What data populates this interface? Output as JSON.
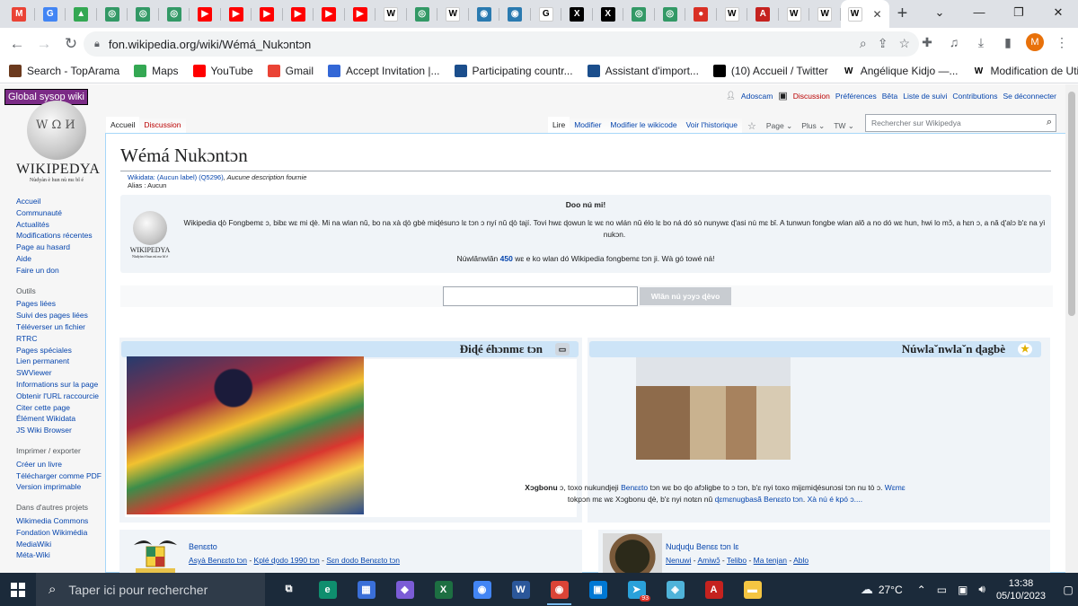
{
  "browser": {
    "tabs": [
      {
        "icon": "gmail-icon",
        "glyph": "M",
        "color": "#ea4335"
      },
      {
        "icon": "google-translate-icon",
        "glyph": "G",
        "color": "#4285f4"
      },
      {
        "icon": "google-drive-icon",
        "glyph": "▲",
        "color": "#34a853"
      },
      {
        "icon": "wikimedia-icon",
        "glyph": "◎",
        "color": "#339966"
      },
      {
        "icon": "wikimedia-icon",
        "glyph": "◎",
        "color": "#339966"
      },
      {
        "icon": "wikimedia-icon",
        "glyph": "◎",
        "color": "#339966"
      },
      {
        "icon": "youtube-icon",
        "glyph": "▶",
        "color": "#ff0000"
      },
      {
        "icon": "youtube-icon",
        "glyph": "▶",
        "color": "#ff0000"
      },
      {
        "icon": "youtube-icon",
        "glyph": "▶",
        "color": "#ff0000"
      },
      {
        "icon": "youtube-icon",
        "glyph": "▶",
        "color": "#ff0000"
      },
      {
        "icon": "youtube-icon",
        "glyph": "▶",
        "color": "#ff0000"
      },
      {
        "icon": "youtube-icon",
        "glyph": "▶",
        "color": "#ff0000"
      },
      {
        "icon": "wikipedia-icon",
        "glyph": "W",
        "color": "#ffffff"
      },
      {
        "icon": "wikimedia-icon",
        "glyph": "◎",
        "color": "#339966"
      },
      {
        "icon": "wikipedia-icon",
        "glyph": "W",
        "color": "#ffffff"
      },
      {
        "icon": "wikiproject-icon",
        "glyph": "◉",
        "color": "#2a7ab0"
      },
      {
        "icon": "wikiproject-icon",
        "glyph": "◉",
        "color": "#2a7ab0"
      },
      {
        "icon": "google-icon",
        "glyph": "G",
        "color": "#ffffff"
      },
      {
        "icon": "x-icon",
        "glyph": "X",
        "color": "#000000"
      },
      {
        "icon": "x-icon",
        "glyph": "X",
        "color": "#000000"
      },
      {
        "icon": "wikimedia-icon",
        "glyph": "◎",
        "color": "#339966"
      },
      {
        "icon": "wikimedia-icon",
        "glyph": "◎",
        "color": "#339966"
      },
      {
        "icon": "record-icon",
        "glyph": "●",
        "color": "#d93025"
      },
      {
        "icon": "wikipedia-icon",
        "glyph": "W",
        "color": "#ffffff"
      },
      {
        "icon": "pdf-icon",
        "glyph": "A",
        "color": "#c5221f"
      },
      {
        "icon": "wikipedia-icon",
        "glyph": "W",
        "color": "#ffffff"
      },
      {
        "icon": "wikipedia-icon",
        "glyph": "W",
        "color": "#ffffff"
      }
    ],
    "active_tab_glyph": "W",
    "close_glyph": "✕",
    "new_tab_glyph": "+",
    "window_controls": [
      "⌄",
      "—",
      "❐",
      "✕"
    ],
    "url": "fon.wikipedia.org/wiki/Wémá_Nukɔntɔn",
    "profile_initial": "M",
    "bookmarks": [
      {
        "icon": "toparama-icon",
        "color": "#6b3a1e",
        "label": "Search - TopArama"
      },
      {
        "icon": "maps-icon",
        "color": "#34a853",
        "label": "Maps"
      },
      {
        "icon": "youtube-icon",
        "color": "#ff0000",
        "label": "YouTube"
      },
      {
        "icon": "gmail-icon",
        "color": "#ea4335",
        "label": "Gmail"
      },
      {
        "icon": "invitation-icon",
        "color": "#3367d6",
        "label": "Accept Invitation |..."
      },
      {
        "icon": "wikimedia-icon",
        "color": "#1b4e8c",
        "label": "Participating countr..."
      },
      {
        "icon": "wikimedia-icon",
        "color": "#1b4e8c",
        "label": "Assistant d'import..."
      },
      {
        "icon": "x-icon",
        "color": "#000000",
        "label": "(10) Accueil / Twitter"
      },
      {
        "icon": "wikipedia-icon",
        "color": "#ffffff",
        "label": "Angélique Kidjo —..."
      },
      {
        "icon": "wikipedia-icon",
        "color": "#ffffff",
        "label": "Modification de Util..."
      }
    ]
  },
  "wiki": {
    "sysop_badge": "Global sysop wiki",
    "wordmark": "WIKIPEDYA",
    "tagline": "Nùdyàn è hun nù mɛ bǐ é",
    "sidebar": {
      "nav": [
        "Accueil",
        "Communauté",
        "Actualités",
        "Modifications récentes",
        "Page au hasard",
        "Aide",
        "Faire un don"
      ],
      "tools_title": "Outils",
      "tools": [
        "Pages liées",
        "Suivi des pages liées",
        "Téléverser un fichier",
        "RTRC",
        "Pages spéciales",
        "Lien permanent",
        "SWViewer",
        "Informations sur la page",
        "Obtenir l'URL raccourcie",
        "Citer cette page",
        "Élément Wikidata",
        "JS Wiki Browser"
      ],
      "print_title": "Imprimer / exporter",
      "print": [
        "Créer un livre",
        "Télécharger comme PDF",
        "Version imprimable"
      ],
      "other_title": "Dans d'autres projets",
      "other": [
        "Wikimedia Commons",
        "Fondation Wikimédia",
        "MediaWiki",
        "Méta-Wiki"
      ]
    },
    "personal": {
      "user": "Adoscam",
      "discussion": "Discussion",
      "preferences": "Préférences",
      "beta": "Bêta",
      "watchlist": "Liste de suivi",
      "contributions": "Contributions",
      "logout": "Se déconnecter"
    },
    "ns_tabs": {
      "main": "Accueil",
      "talk": "Discussion"
    },
    "view_tabs": {
      "read": "Lire",
      "edit": "Modifier",
      "edit_source": "Modifier le wikicode",
      "history": "Voir l'historique",
      "page": "Page",
      "more": "Plus",
      "tw": "TW"
    },
    "search_placeholder": "Rechercher sur Wikipedya",
    "title": "Wémá Nukɔntɔn",
    "wikidata_line": "Wikidata: (Aucun label) (Q5296), Aucune description fournie",
    "wikidata_link": "Wikidata: (Aucun label) (Q5296)",
    "wikidata_desc": ", Aucune description fournie",
    "alias_line": "Alias : Aucun",
    "welcome": {
      "heading": "Doo nú mi!",
      "body": "Wikipedia ɖò Fongbemɛ ɔ, bibɛ wɛ mi ɖè. Mi na wlan nǔ, bo na xà ɖò gbè miɖésunɔ lɛ tɔn ɔ nyí nǔ ɖò tají. Tovi hwɛ ɖowun lɛ wɛ no wlán nǔ élo lɛ bo ná dó sò nunywɛ ɖ'asi nú mɛ bǐ. A tunwun fongbe wlan alǒ a no dó wɛ hun, hwi lo mɔ̌, a hɛn ɔ, a nǎ ɖ'alɔ b'ɛ na yì nukɔn.",
      "count_prefix": "Núwlǎnwlǎn",
      "count": "450",
      "count_suffix": "wɛ e ko wlan dó Wikipedia fongbemɛ tɔn ji. Wà gó towé ná!"
    },
    "search_button": "Wlǎn nú yɔyɔ ɖèvo",
    "panel_left_title": "Ɖiɖé éhɔnmɛ tɔn",
    "panel_right_title": "Núwlaˇnwlaˇn ɖagbè",
    "featured": {
      "bold": "Xɔgbonu",
      "text1": " ɔ, toxo nukundjeji ",
      "link1": "Benɛɛto",
      "text2": " tɔn wɛ bo ɖo afɔligbe to ɔ tɔn, b'ɛ nyi toxo mijɛmiɖésunɔsi tɔn nu tò ɔ. ",
      "link2": "Wɛmɛ",
      "text3": "tokpɔn mɛ wɛ Xɔgbonu ɖè, b'ɛ nyi notɛn nǔ ",
      "link3": "ɖɛmɛnugbasã Benɛɛto tɔn",
      "text4": ". ",
      "link4": "Xà nú é kpó ɔ...."
    },
    "bottom_left": {
      "title": "Benɛɛto",
      "links": [
        "Asyà Benɛɛto tɔn",
        "Kplé ɖodo 1990 tɔn",
        "Sɛn dodo Benɛɛto tɔn"
      ]
    },
    "bottom_right": {
      "title": "Nuɖuɖu Benɛɛ tɔn lɛ",
      "links": [
        "Nenuwi",
        "Amiwɔ̌",
        "Telibo",
        "Ma tenjan",
        "Ablo"
      ]
    }
  },
  "taskbar": {
    "search_placeholder": "Taper ici pour rechercher",
    "apps": [
      {
        "icon": "task-view-icon",
        "glyph": "⧉",
        "color": "transparent"
      },
      {
        "icon": "edge-icon",
        "glyph": "e",
        "color": "#0f8e6e"
      },
      {
        "icon": "store-icon",
        "glyph": "▦",
        "color": "#3a6fd8"
      },
      {
        "icon": "copilot-icon",
        "glyph": "◆",
        "color": "#7b5cd6"
      },
      {
        "icon": "excel-icon",
        "glyph": "X",
        "color": "#1d6f42"
      },
      {
        "icon": "chrome-icon",
        "glyph": "◉",
        "color": "#4285f4"
      },
      {
        "icon": "word-icon",
        "glyph": "W",
        "color": "#2b579a"
      },
      {
        "icon": "chrome-profile-icon",
        "glyph": "◉",
        "color": "#db4437"
      },
      {
        "icon": "photos-icon",
        "glyph": "▣",
        "color": "#0078d4"
      },
      {
        "icon": "telegram-icon",
        "glyph": "➤",
        "color": "#2aa1da"
      },
      {
        "icon": "files-icon",
        "glyph": "◈",
        "color": "#4fb3d9"
      },
      {
        "icon": "acrobat-icon",
        "glyph": "A",
        "color": "#c5221f"
      },
      {
        "icon": "explorer-icon",
        "glyph": "▬",
        "color": "#f4c542"
      }
    ],
    "telegram_badge": "93",
    "temperature": "27°C",
    "time": "13:38",
    "date": "05/10/2023"
  }
}
